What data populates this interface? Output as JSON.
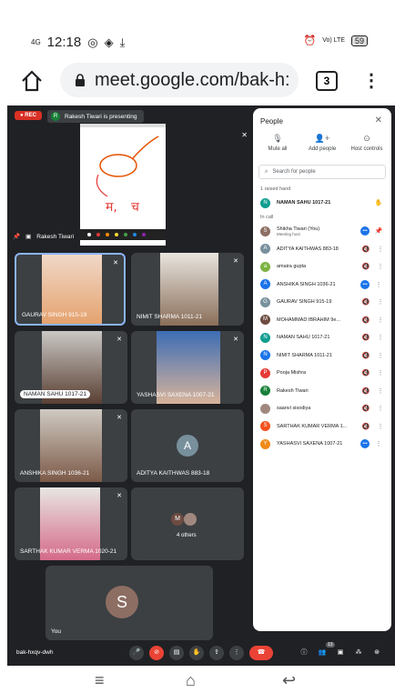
{
  "status": {
    "signal": "4G",
    "time": "12:18",
    "net_badge": "Vo) LTE",
    "battery": "59"
  },
  "browser": {
    "url": "meet.google.com/bak-h:",
    "tab_count": "3"
  },
  "meet": {
    "rec_label": "REC",
    "presenter_initial": "R",
    "presenting_text": "Rakesh Tiwari is presenting",
    "share_name": "Rakesh Tiwari",
    "meeting_code": "bak-hxqv-dwh",
    "people_badge": "13",
    "tiles": [
      {
        "name": "GAURAV SINGH 915-19"
      },
      {
        "name": "NIMIT SHARMA 1011-21"
      },
      {
        "name": "NAMAN SAHU 1017-21"
      },
      {
        "name": "YASHASVI SAXENA 1007-21"
      },
      {
        "name": "ANSHIKA SINGH 1036-21"
      },
      {
        "name": "ADITYA KAITHWAS 883-18",
        "initial": "A"
      },
      {
        "name": "SARTHAK KUMAR VERMA 1020-21"
      },
      {
        "name": "4 others",
        "initial": "M"
      }
    ],
    "self_tile": {
      "name": "You",
      "initial": "S"
    }
  },
  "people": {
    "title": "People",
    "actions": [
      "Mute all",
      "Add people",
      "Host controls"
    ],
    "search_placeholder": "Search for people",
    "raised_label": "1 raised hand",
    "raised": {
      "initial": "N",
      "name": "NAMAN SAHU 1017-21",
      "color": "#0f9d8f"
    },
    "in_call_label": "In call",
    "list": [
      {
        "initial": "S",
        "name": "Shikha Tiwari (You)",
        "sub": "Meeting host",
        "color": "#8d6e63"
      },
      {
        "initial": "A",
        "name": "ADITYA KAITHWAS 883-18",
        "color": "#78909c"
      },
      {
        "initial": "a",
        "name": "amaira gupta",
        "color": "#7cb342"
      },
      {
        "initial": "A",
        "name": "ANSHIKA SINGH 1036-21",
        "color": "#1a73e8"
      },
      {
        "initial": "G",
        "name": "GAURAV SINGH 915-19",
        "color": "#78909c"
      },
      {
        "initial": "M",
        "name": "MOHAMMAD IBRAHIM 9e...",
        "color": "#6d4c41"
      },
      {
        "initial": "N",
        "name": "NAMAN SAHU 1017-21",
        "color": "#0f9d8f"
      },
      {
        "initial": "N",
        "name": "NIMIT SHARMA 1011-21",
        "color": "#1a73e8"
      },
      {
        "initial": "P",
        "name": "Pooja Mishra",
        "color": "#e53935"
      },
      {
        "initial": "R",
        "name": "Rakesh Tiwari",
        "color": "#188038"
      },
      {
        "initial": "",
        "name": "saanvi sisodiya",
        "color": "#a1887f"
      },
      {
        "initial": "S",
        "name": "SARTHAK KUMAR VERMA 1...",
        "color": "#f4511e"
      },
      {
        "initial": "Y",
        "name": "YASHASVI SAXENA 1007-21",
        "color": "#ef8a1a"
      }
    ]
  }
}
